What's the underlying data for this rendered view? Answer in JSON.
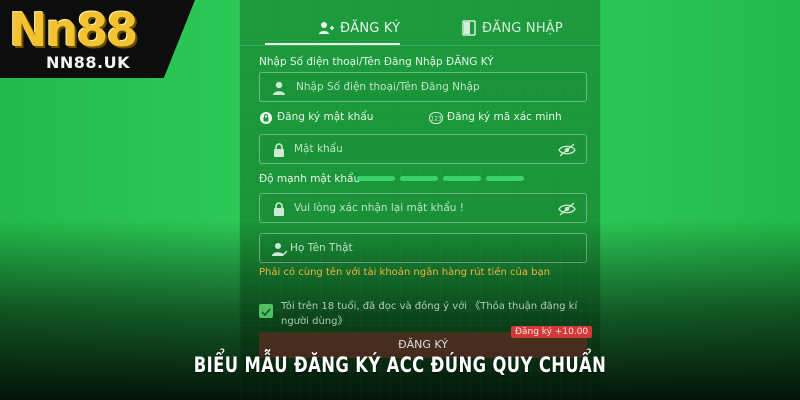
{
  "brand": {
    "logo_text": "Nn88",
    "logo_sub": "NN88.UK",
    "logo_color": "#f2c230"
  },
  "tabs": [
    {
      "label": "ĐĂNG KÝ",
      "icon": "user-plus-icon",
      "active": true
    },
    {
      "label": "ĐĂNG NHẬP",
      "icon": "login-door-icon",
      "active": false
    }
  ],
  "form": {
    "phone_label": "Nhập Số điện thoại/Tên Đăng Nhập ĐĂNG KÝ",
    "phone_placeholder": "Nhập Số điện thoại/Tên Đăng Nhập",
    "register_password_option": "Đăng ký mật khẩu",
    "register_code_option": "Đăng ký mã xác minh",
    "password_placeholder": "Mật khẩu",
    "strength_label": "Độ mạnh mật khẩu",
    "strength_level": 4,
    "confirm_placeholder": "Vui lòng xác nhận lại mật khẩu !",
    "name_placeholder": "Họ Tên Thật",
    "name_hint": "Phải có cùng tên với tài khoản ngân hàng rút tiền của bạn",
    "agree_text": "Tôi trên 18 tuổi, đã đọc và đồng ý với 《Thỏa thuận đăng kí người dùng》",
    "agree_checked": true,
    "submit_label": "ĐĂNG KÝ",
    "bonus_badge": "Đăng ký +10.00"
  },
  "caption": "BIỂU MẪU ĐĂNG KÝ ACC ĐÚNG QUY CHUẨN",
  "colors": {
    "accent_green": "#2bc653",
    "warning": "#f0b53b",
    "strength": "#39d36a"
  }
}
